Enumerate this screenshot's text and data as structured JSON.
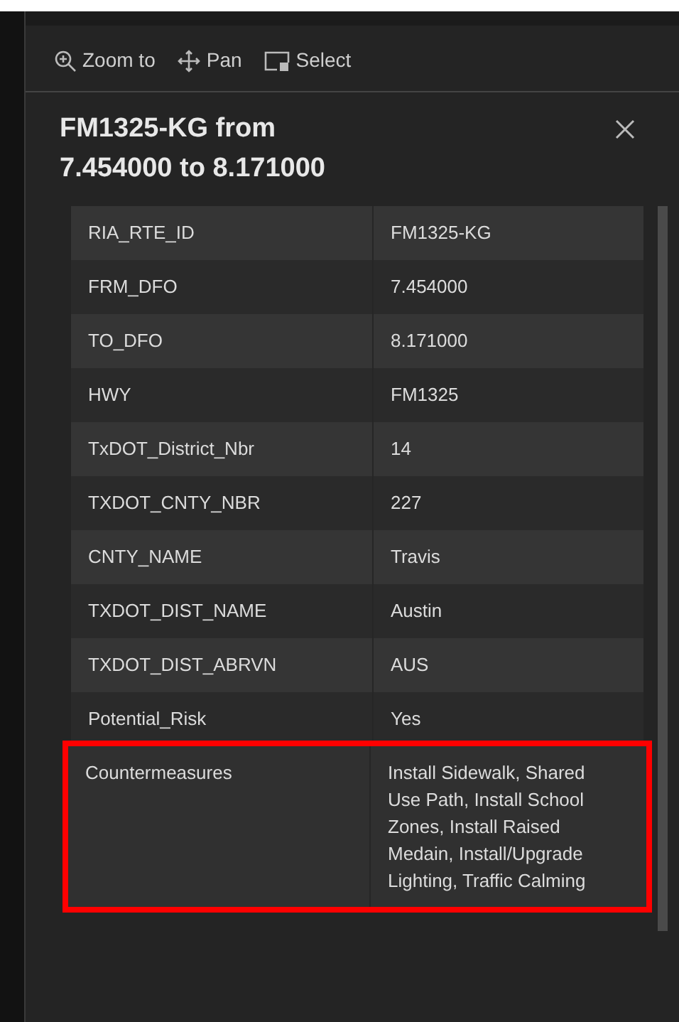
{
  "toolbar": [
    {
      "label": "Zoom to"
    },
    {
      "label": "Pan"
    },
    {
      "label": "Select"
    }
  ],
  "popup": {
    "title": "FM1325-KG from 7.454000 to 8.171000"
  },
  "rows": [
    {
      "field": "RIA_RTE_ID",
      "value": "FM1325-KG",
      "highlighted": false
    },
    {
      "field": "FRM_DFO",
      "value": "7.454000",
      "highlighted": false
    },
    {
      "field": "TO_DFO",
      "value": "8.171000",
      "highlighted": false
    },
    {
      "field": "HWY",
      "value": "FM1325",
      "highlighted": false
    },
    {
      "field": "TxDOT_District_Nbr",
      "value": "14",
      "highlighted": false
    },
    {
      "field": "TXDOT_CNTY_NBR",
      "value": "227",
      "highlighted": false
    },
    {
      "field": "CNTY_NAME",
      "value": "Travis",
      "highlighted": false
    },
    {
      "field": "TXDOT_DIST_NAME",
      "value": "Austin",
      "highlighted": false
    },
    {
      "field": "TXDOT_DIST_ABRVN",
      "value": "AUS",
      "highlighted": false
    },
    {
      "field": "Potential_Risk",
      "value": "Yes",
      "highlighted": false
    },
    {
      "field": "Countermeasures",
      "value": "Install Sidewalk, Shared Use Path, Install School Zones, Install Raised Medain, Install/Upgrade Lighting, Traffic Calming",
      "highlighted": true
    }
  ]
}
